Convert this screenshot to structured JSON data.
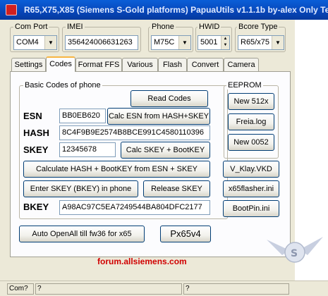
{
  "window": {
    "title": "R65,X75,X85 (Siemens S-Gold platforms) PapuaUtils v1.1.1b by-alex Only Te"
  },
  "toolbar": {
    "com_port": {
      "label": "Com Port",
      "value": "COM4"
    },
    "imei": {
      "label": "IMEI",
      "value": "356424006631263"
    },
    "phone": {
      "label": "Phone",
      "value": "M75C"
    },
    "hwid": {
      "label": "HWID",
      "value": "5001"
    },
    "bcore": {
      "label": "Bcore Type",
      "value": "R65/x75"
    }
  },
  "tabs": [
    "Settings",
    "Codes",
    "Format FFS",
    "Various",
    "Flash",
    "Convert",
    "Camera"
  ],
  "active_tab": "Codes",
  "basic_codes": {
    "title": "Basic Codes of phone",
    "read_codes": "Read Codes",
    "esn_label": "ESN",
    "esn_value": "BB0EB620",
    "calc_esn": "Calc ESN from HASH+SKEY",
    "hash_label": "HASH",
    "hash_value": "8C4F9B9E2574B8BCE991C4580110396",
    "skey_label": "SKEY",
    "skey_value": "12345678",
    "calc_skey": "Calc SKEY + BootKEY",
    "calc_hash": "Calculate HASH + BootKEY from ESN + SKEY",
    "enter_skey": "Enter SKEY (BKEY) in phone",
    "release_skey": "Release SKEY",
    "bkey_label": "BKEY",
    "bkey_value": "A98AC97C5EA7249544BA804DFC2177"
  },
  "eeprom": {
    "title": "EEPROM",
    "new512": "New 512x",
    "freia": "Freia.log",
    "new0052": "New 0052"
  },
  "side_buttons": {
    "klay": "V_Klay.VKD",
    "x65flasher": "x65flasher.ini",
    "bootpin": "BootPin.ini"
  },
  "auto_open": "Auto OpenAll till fw36 for x65",
  "px65": "Px65v4",
  "forum": "forum.allsiemens.com",
  "status": {
    "com": "Com?",
    "cell2": "?",
    "cell3": "?"
  }
}
